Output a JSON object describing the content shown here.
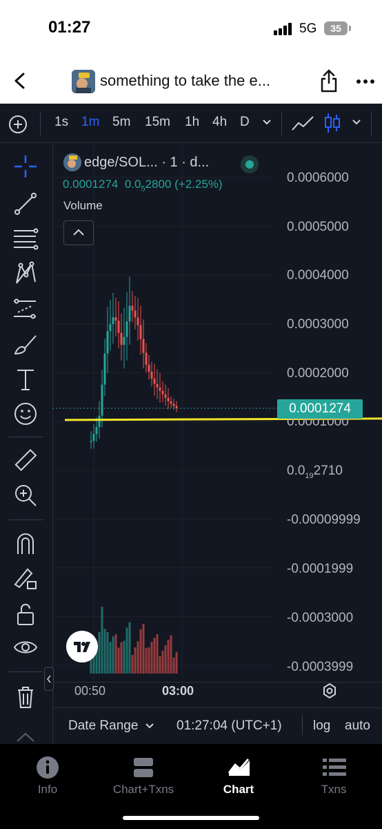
{
  "status_bar": {
    "time": "01:27",
    "network": "5G",
    "battery": "35"
  },
  "header": {
    "title": "something to take the e..."
  },
  "toolbar": {
    "timeframes": [
      {
        "label": "1s",
        "active": false
      },
      {
        "label": "1m",
        "active": true
      },
      {
        "label": "5m",
        "active": false
      },
      {
        "label": "15m",
        "active": false
      },
      {
        "label": "1h",
        "active": false
      },
      {
        "label": "4h",
        "active": false
      },
      {
        "label": "D",
        "active": false
      }
    ]
  },
  "legend": {
    "symbol": "edge/SOL...",
    "interval": "· 1 · d...",
    "price": "0.0001274",
    "change_prefix": "0.0",
    "change_sub": "5",
    "change_rest": "2800 (+2.25%)",
    "volume": "Volume"
  },
  "price_axis": {
    "labels": [
      "0.0006000",
      "0.0005000",
      "0.0004000",
      "0.0003000",
      "0.0002000",
      "0.0001000",
      "-0.00009999",
      "-0.0001999",
      "-0.0003000",
      "-0.0003999"
    ],
    "tiny_label": {
      "prefix": "0.0",
      "sub": "19",
      "rest": "2710"
    },
    "last_price": "0.0001274"
  },
  "time_axis": {
    "labels": [
      "00:50",
      "03:00"
    ]
  },
  "bottom_bar": {
    "date_range": "Date Range",
    "clock": "01:27:04 (UTC+1)",
    "log": "log",
    "auto": "auto"
  },
  "tabs": [
    {
      "label": "Info",
      "icon": "info-icon"
    },
    {
      "label": "Chart+Txns",
      "icon": "split-icon"
    },
    {
      "label": "Chart",
      "icon": "chart-icon",
      "active": true
    },
    {
      "label": "Txns",
      "icon": "list-icon"
    }
  ],
  "chart_data": {
    "type": "line",
    "title": "",
    "series": [
      {
        "name": "",
        "values": [
          6e-05,
          0.0001,
          0.00028,
          0.00032,
          0.00025,
          0.00034,
          0.0003,
          0.00022,
          0.00018,
          0.00016,
          0.00014,
          0.000127
        ]
      }
    ],
    "horizontal_line": 0.000103,
    "ylim": [
      -0.0004,
      0.00065
    ],
    "colors": {
      "up": "#26a69a",
      "down": "#ef5350",
      "line": "#f5e52a"
    }
  }
}
